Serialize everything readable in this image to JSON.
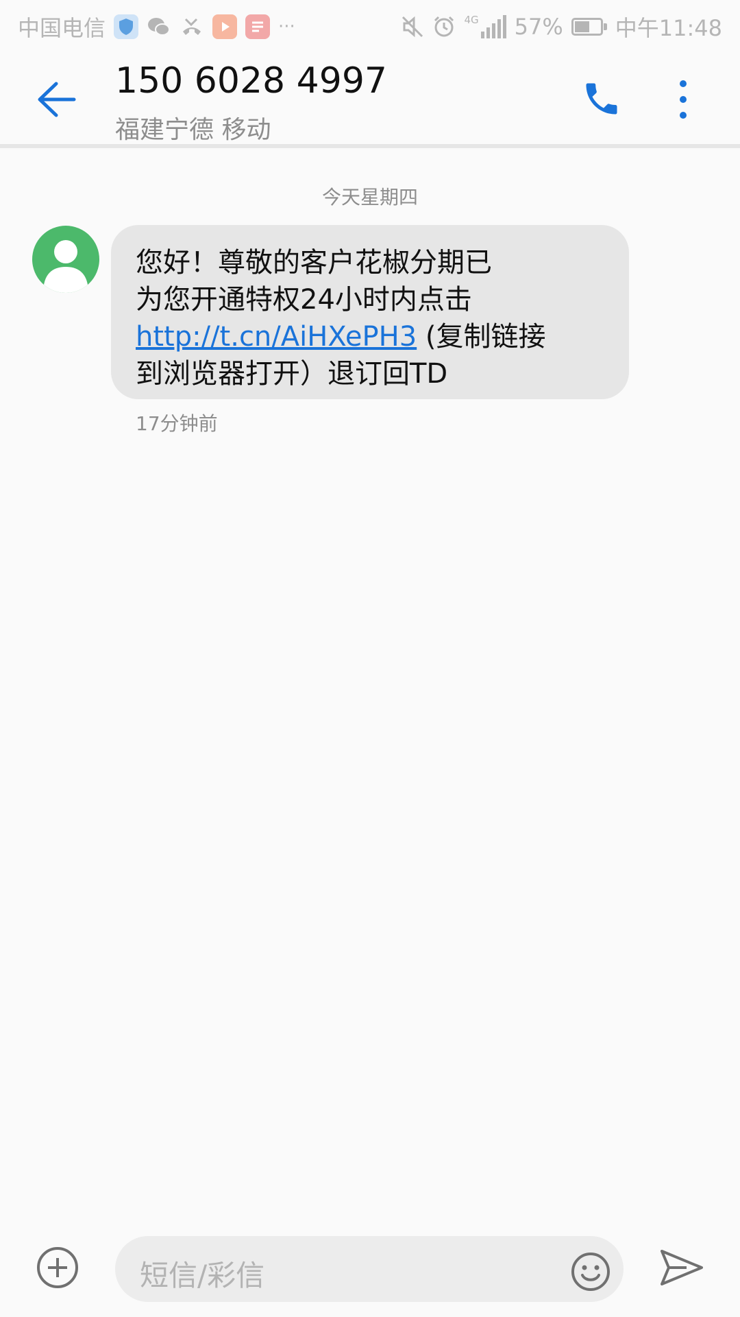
{
  "status_bar": {
    "carrier": "中国电信",
    "more": "···",
    "network": "4G",
    "battery": "57%",
    "time": "中午11:48"
  },
  "header": {
    "contact_number": "150 6028 4997",
    "contact_location": "福建宁德 移动"
  },
  "thread": {
    "date_separator": "今天星期四",
    "message": {
      "line1": "您好！尊敬的客户花椒分期已",
      "line2": "为您开通特权24小时内点击",
      "link": "http://t.cn/AiHXePH3",
      "line3_suffix": "(复制链接",
      "line4": "到浏览器打开）退订回TD",
      "time": "17分钟前"
    }
  },
  "composer": {
    "placeholder": "短信/彩信"
  },
  "colors": {
    "accent": "#1a73d9",
    "avatar": "#4cb96b",
    "bubble": "#e6e6e6"
  },
  "icons": [
    "shield-icon",
    "wechat-icon",
    "missed-call-icon",
    "video-app-icon",
    "news-app-icon",
    "mute-icon",
    "alarm-icon",
    "signal-icon",
    "battery-icon",
    "back-arrow-icon",
    "phone-icon",
    "more-vertical-icon",
    "person-icon",
    "add-circle-icon",
    "smiley-icon",
    "send-icon"
  ]
}
